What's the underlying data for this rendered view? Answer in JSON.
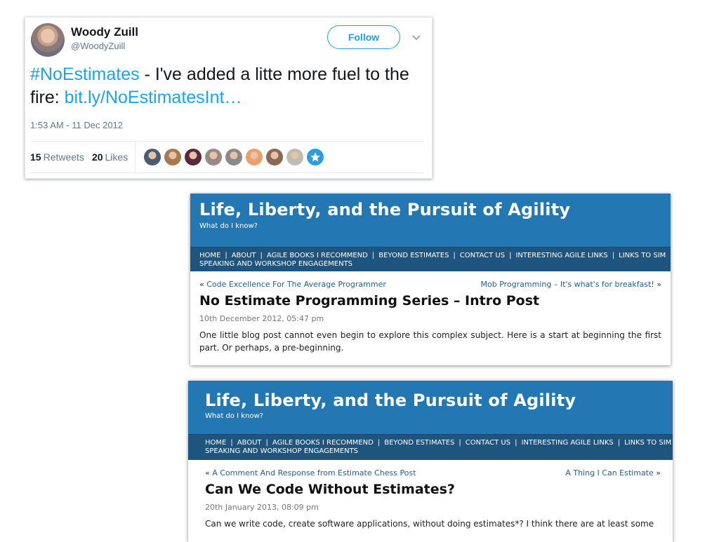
{
  "tweet": {
    "name": "Woody Zuill",
    "handle": "@WoodyZuill",
    "follow_label": "Follow",
    "text_hashtag": "#NoEstimates",
    "text_middle": " - I've added a litte more fuel to the fire: ",
    "text_link": "bit.ly/NoEstimatesInt…",
    "timestamp": "1:53 AM - 11 Dec 2012",
    "retweets_count": "15",
    "retweets_label": "Retweets",
    "likes_count": "20",
    "likes_label": "Likes",
    "liker_avatars": [
      {
        "name": "liker-avatar-1",
        "color": "#4d5b72"
      },
      {
        "name": "liker-avatar-2",
        "color": "#a8794e"
      },
      {
        "name": "liker-avatar-3",
        "color": "#5a2a3c"
      },
      {
        "name": "liker-avatar-4",
        "color": "#9a8a86"
      },
      {
        "name": "liker-avatar-5",
        "color": "#8a8a8a"
      },
      {
        "name": "liker-avatar-6",
        "color": "#e9a06a"
      },
      {
        "name": "liker-avatar-7",
        "color": "#8a6a52"
      },
      {
        "name": "liker-avatar-8",
        "color": "#bfbcb4"
      }
    ],
    "colors": {
      "accent": "#1da1f2",
      "text": "#14171a",
      "muted": "#657786"
    }
  },
  "blogs": [
    {
      "site_title": "Life, Liberty, and the Pursuit of Agility",
      "tagline": "What do I know?",
      "nav_items": [
        "HOME",
        "ABOUT",
        "AGILE BOOKS I RECOMMEND",
        "BEYOND ESTIMATES",
        "CONTACT US",
        "INTERESTING AGILE LINKS",
        "LINKS TO SIM"
      ],
      "nav_second_line": "SPEAKING AND WORKSHOP ENGAGEMENTS",
      "prev_post": "Code Excellence For The Average Programmer",
      "next_post": "Mob Programming – It's what's for breakfast!",
      "post_title": "No Estimate Programming Series – Intro Post",
      "post_date": "10th December 2012, 05:47 pm",
      "post_body": "One little blog post cannot even begin to explore this complex subject.  Here is a start at beginning the first part. Or perhaps, a pre-beginning."
    },
    {
      "site_title": "Life, Liberty, and the Pursuit of Agility",
      "tagline": "What do I know?",
      "nav_items": [
        "HOME",
        "ABOUT",
        "AGILE BOOKS I RECOMMEND",
        "BEYOND ESTIMATES",
        "CONTACT US",
        "INTERESTING AGILE LINKS",
        "LINKS TO SIM"
      ],
      "nav_second_line": "SPEAKING AND WORKSHOP ENGAGEMENTS",
      "prev_post": "A Comment And Response from Estimate Chess Post",
      "next_post": "A Thing I Can Estimate",
      "post_title": "Can We Code Without Estimates?",
      "post_date": "20th January 2013, 08:09 pm",
      "post_body": "Can we write code, create software applications, without doing estimates*?  I think there are at least some"
    }
  ],
  "symbols": {
    "prev_arrow": "« ",
    "next_arrow": " »",
    "nav_separator": "|"
  },
  "colors": {
    "blog_header": "#2378b4",
    "blog_nav": "#1f547e",
    "blog_link": "#215f91"
  }
}
